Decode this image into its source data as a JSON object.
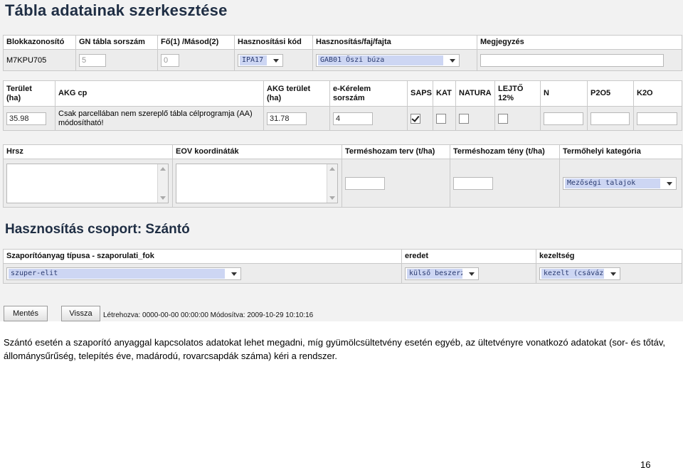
{
  "title": "Tábla adatainak szerkesztése",
  "row1": {
    "headers": [
      "Blokkazonosító",
      "GN tábla sorszám",
      "Fő(1) /Másod(2)",
      "Hasznosítási kód",
      "Hasznosítás/faj/fajta",
      "Megjegyzés"
    ],
    "blokk_id": "M7KPU705",
    "gn_sorszam": "5",
    "fo_masod": "0",
    "hasznositasi_kod": "IPA17",
    "hasznositas_faj": "GAB01 Őszi búza",
    "megjegyzes": ""
  },
  "row2": {
    "terulet_label_1": "Terület",
    "terulet_label_2": "(ha)",
    "akg_cp_label": "AKG cp",
    "akg_terulet_label_1": "AKG terület",
    "akg_terulet_label_2": "(ha)",
    "ekerelem_label_1": "e-Kérelem",
    "ekerelem_label_2": "sorszám",
    "saps_label": "SAPS",
    "kat_label": "KAT",
    "natura_label": "NATURA",
    "lejto_label_1": "LEJTŐ",
    "lejto_label_2": "12%",
    "n_label": "N",
    "p2o5_label": "P2O5",
    "k2o_label": "K2O",
    "terulet": "35.98",
    "akg_cp_note": "Csak parcellában nem szereplő tábla célprogramja (AA) módosítható!",
    "akg_terulet": "31.78",
    "ekerelem": "4",
    "saps_checked": true,
    "kat_checked": false,
    "natura_checked": false,
    "lejto_checked": false,
    "n": "",
    "p2o5": "",
    "k2o": ""
  },
  "row3": {
    "headers": [
      "Hrsz",
      "EOV koordináták",
      "Terméshozam terv (t/ha)",
      "Terméshozam tény (t/ha)",
      "Termőhelyi kategória"
    ],
    "hrsz": "",
    "eov": "",
    "hozam_terv": "",
    "hozam_teny": "",
    "termohelyi": "Mezőségi talajok"
  },
  "group_title": "Hasznosítás csoport: Szántó",
  "row4": {
    "headers": [
      "Szaporítóanyag típusa - szaporulati_fok",
      "eredet",
      "kezeltség"
    ],
    "szaporito": "szuper-elit",
    "eredet": "külső beszerzés",
    "kezeltseg": "kezelt (csávázott)"
  },
  "buttons": {
    "save": "Mentés",
    "back": "Vissza"
  },
  "meta": "Létrehozva: 0000-00-00 00:00:00 Módosítva: 2009-10-29 10:10:16",
  "paragraph": "Szántó esetén a szaporító anyaggal kapcsolatos adatokat lehet megadni, míg gyümölcsültetvény esetén egyéb, az ültetvényre vonatkozó adatokat (sor- és tőtáv, állománysűrűség, telepítés éve, madárodú, rovarcsapdák száma) kéri a rendszer.",
  "page_number": "16"
}
